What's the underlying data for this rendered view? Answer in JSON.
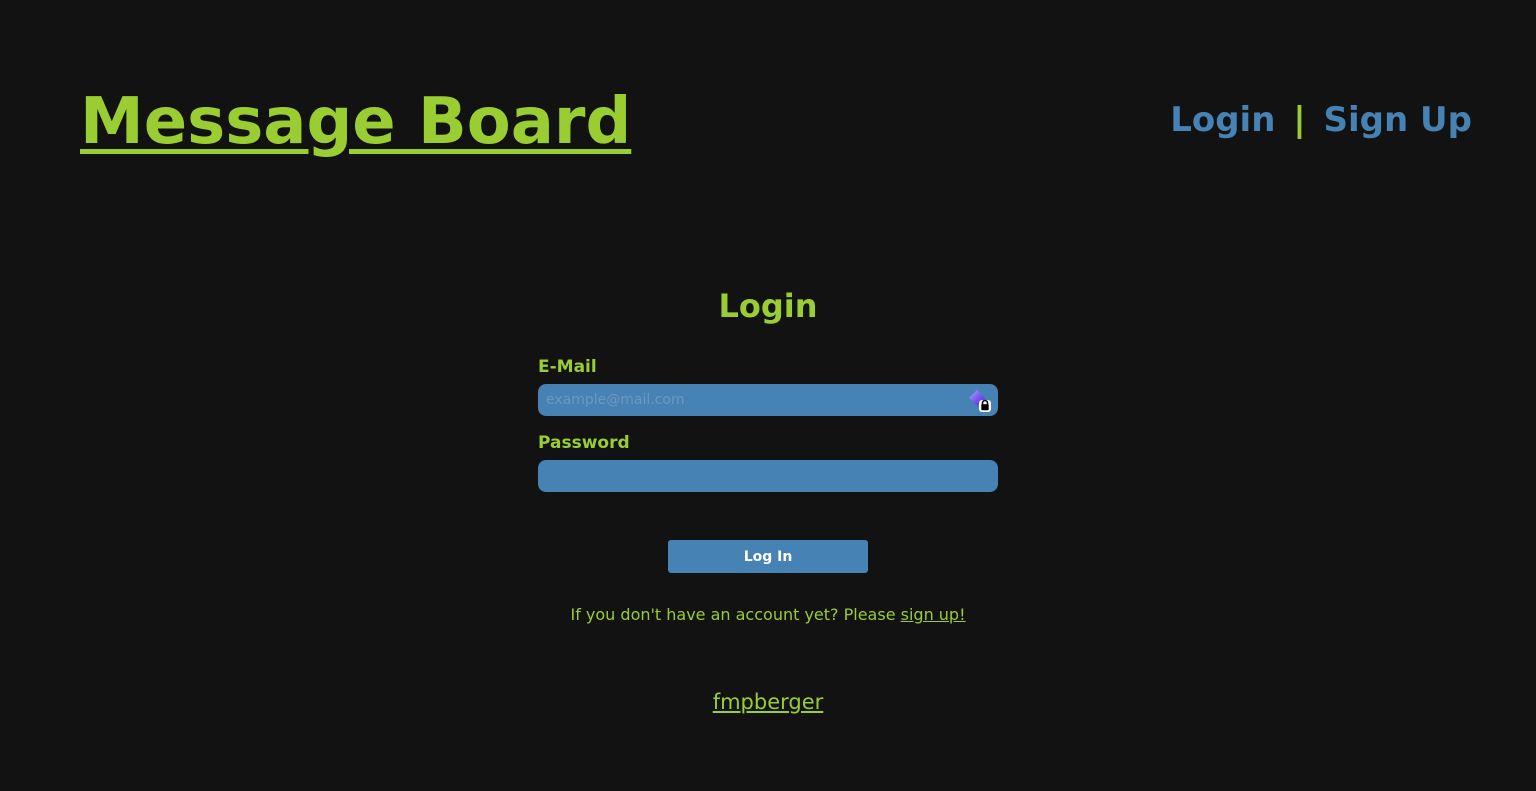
{
  "header": {
    "title": "Message Board",
    "nav": {
      "login": "Login",
      "separator": "|",
      "signup": "Sign Up"
    }
  },
  "form": {
    "title": "Login",
    "email": {
      "label": "E-Mail",
      "placeholder": "example@mail.com",
      "value": ""
    },
    "password": {
      "label": "Password",
      "value": ""
    },
    "submit_label": "Log In",
    "signup_prompt": "If you don't have an account yet? Please ",
    "signup_link": "sign up!"
  },
  "footer": {
    "author_link": "fmpberger"
  },
  "colors": {
    "background": "#121212",
    "accent_green": "#9acd32",
    "accent_blue": "#4682b4"
  },
  "icons": {
    "password_manager": "password-manager-lock-icon"
  }
}
